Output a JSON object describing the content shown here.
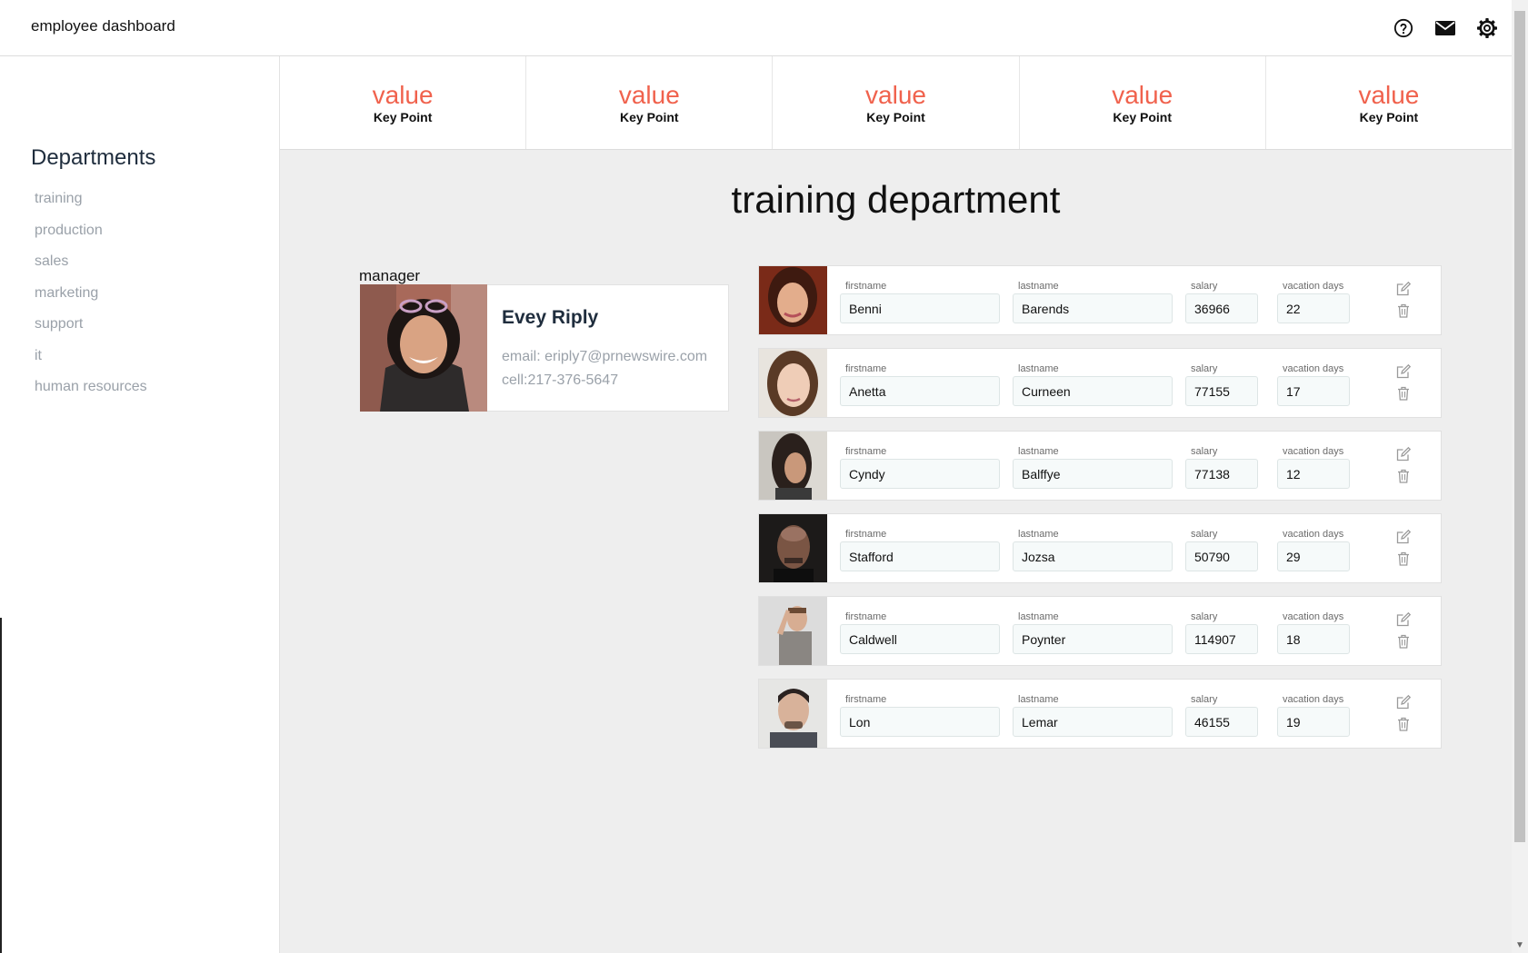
{
  "app": {
    "title": "employee dashboard"
  },
  "header_icons": [
    "help-icon",
    "mail-icon",
    "gear-icon"
  ],
  "sidebar": {
    "heading": "Departments",
    "items": [
      {
        "label": "training"
      },
      {
        "label": "production"
      },
      {
        "label": "sales"
      },
      {
        "label": "marketing"
      },
      {
        "label": "support"
      },
      {
        "label": "it"
      },
      {
        "label": "human resources"
      }
    ]
  },
  "kpis": [
    {
      "value": "value",
      "label": "Key Point"
    },
    {
      "value": "value",
      "label": "Key Point"
    },
    {
      "value": "value",
      "label": "Key Point"
    },
    {
      "value": "value",
      "label": "Key Point"
    },
    {
      "value": "value",
      "label": "Key Point"
    }
  ],
  "department": {
    "title": "training department",
    "manager_label": "manager",
    "manager": {
      "name": "Evey Riply",
      "email": "email: eriply7@prnewswire.com",
      "cell": "cell:217-376-5647"
    }
  },
  "field_labels": {
    "firstname": "firstname",
    "lastname": "lastname",
    "salary": "salary",
    "vacation": "vacation days"
  },
  "employees": [
    {
      "firstname": "Benni",
      "lastname": "Barends",
      "salary": "36966",
      "vacation": "22"
    },
    {
      "firstname": "Anetta",
      "lastname": "Curneen",
      "salary": "77155",
      "vacation": "17"
    },
    {
      "firstname": "Cyndy",
      "lastname": "Balffye",
      "salary": "77138",
      "vacation": "12"
    },
    {
      "firstname": "Stafford",
      "lastname": "Jozsa",
      "salary": "50790",
      "vacation": "29"
    },
    {
      "firstname": "Caldwell",
      "lastname": "Poynter",
      "salary": "114907",
      "vacation": "18"
    },
    {
      "firstname": "Lon",
      "lastname": "Lemar",
      "salary": "46155",
      "vacation": "19"
    }
  ],
  "colors": {
    "accent": "#f0624d",
    "muted": "#9aa1a9",
    "background": "#eeeeee"
  }
}
